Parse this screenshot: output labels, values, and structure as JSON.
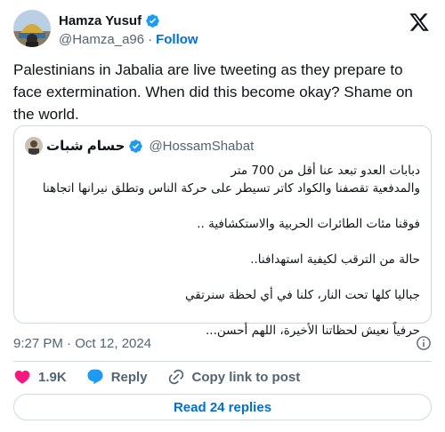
{
  "author": {
    "name": "Hamza Yusuf",
    "handle": "@Hamza_a96",
    "separator": "·",
    "follow_label": "Follow"
  },
  "tweet": {
    "text": "Palestinians in Jabalia are live tweeting as they prepare to face extermination. When did this become okay? Shame on the world."
  },
  "quote": {
    "name": "حسام شبات",
    "handle": "@HossamShabat",
    "lines": [
      "دبابات العدو تبعد عنا أقل من 700 متر",
      "والمدفعية تقصفنا والكواد كاتر تسيطر على حركة الناس وتطلق نيرانها اتجاهنا",
      "",
      "فوقنا مئات الطائرات الحربية والاستكشافية ..",
      "",
      "حالة من الترقب لكيفية استهدافنا..",
      "",
      "جباليا كلها تحت النار، كلنا في أي لحظة سنرتقي",
      "",
      "حرفياً نعيش لحظاتنا الأخيرة، اللهم أحسن..."
    ]
  },
  "meta": {
    "timestamp": "9:27 PM · Oct 12, 2024"
  },
  "actions": {
    "like_count": "1.9K",
    "reply_label": "Reply",
    "copy_label": "Copy link to post"
  },
  "replies_button": "Read 24 replies",
  "colors": {
    "accent": "#006fd6",
    "verified": "#1d9bf0",
    "like": "#f91880",
    "border": "#cfd9de",
    "muted": "#536471"
  },
  "icons": [
    "verified-badge-icon",
    "x-logo-icon",
    "info-icon",
    "heart-icon",
    "reply-bubble-icon",
    "link-icon"
  ]
}
